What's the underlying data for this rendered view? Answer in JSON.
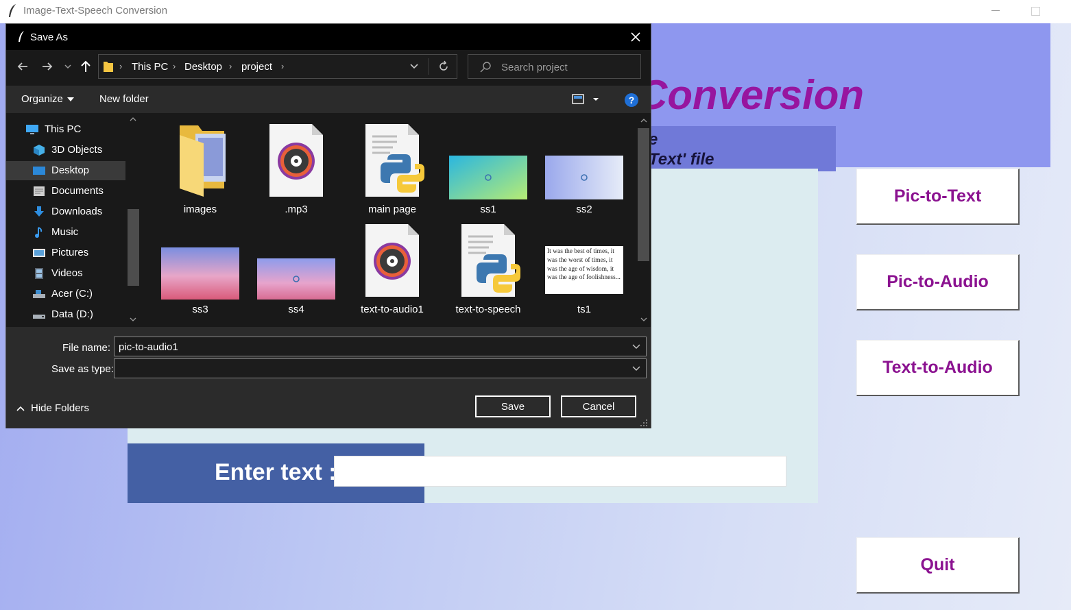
{
  "app": {
    "title": "Image-Text-Speech Conversion",
    "heading_visible": "Conversion",
    "subtitle_line1": "e",
    "subtitle_line2": "Text' file",
    "enter_label": "Enter text :",
    "buttons": {
      "pic_to_text": "Pic-to-Text",
      "pic_to_audio": "Pic-to-Audio",
      "text_to_audio": "Text-to-Audio",
      "quit": "Quit"
    },
    "colors": {
      "banner": "#8e97ef",
      "heading": "#97159f",
      "button_text": "#8b1290",
      "enter_box": "#4460a4"
    }
  },
  "dialog": {
    "title": "Save As",
    "breadcrumb": [
      "This PC",
      "Desktop",
      "project"
    ],
    "search_placeholder": "Search project",
    "toolbar": {
      "organize": "Organize",
      "new_folder": "New folder"
    },
    "sidebar": [
      {
        "label": "This PC",
        "icon": "computer-icon"
      },
      {
        "label": "3D Objects",
        "icon": "cube-icon"
      },
      {
        "label": "Desktop",
        "icon": "desktop-icon",
        "selected": true
      },
      {
        "label": "Documents",
        "icon": "documents-icon"
      },
      {
        "label": "Downloads",
        "icon": "download-icon"
      },
      {
        "label": "Music",
        "icon": "music-icon"
      },
      {
        "label": "Pictures",
        "icon": "pictures-icon"
      },
      {
        "label": "Videos",
        "icon": "videos-icon"
      },
      {
        "label": "Acer (C:)",
        "icon": "drive-icon"
      },
      {
        "label": "Data (D:)",
        "icon": "drive-icon"
      }
    ],
    "files": [
      {
        "name": "images",
        "type": "folder"
      },
      {
        "name": ".mp3",
        "type": "audio"
      },
      {
        "name": "main page",
        "type": "python"
      },
      {
        "name": "ss1",
        "type": "image"
      },
      {
        "name": "ss2",
        "type": "image"
      },
      {
        "name": "ss3",
        "type": "image"
      },
      {
        "name": "ss4",
        "type": "image"
      },
      {
        "name": "text-to-audio1",
        "type": "audio"
      },
      {
        "name": "text-to-speech",
        "type": "python"
      },
      {
        "name": "ts1",
        "type": "text-image"
      }
    ],
    "ts1_preview": "It was the best of times, it was the worst of times, it was the age of wisdom, it was the age of foolishness...",
    "file_name_label": "File name:",
    "file_name_value": "pic-to-audio1",
    "save_type_label": "Save as type:",
    "save_type_value": "",
    "hide_folders": "Hide Folders",
    "save_button": "Save",
    "cancel_button": "Cancel"
  }
}
